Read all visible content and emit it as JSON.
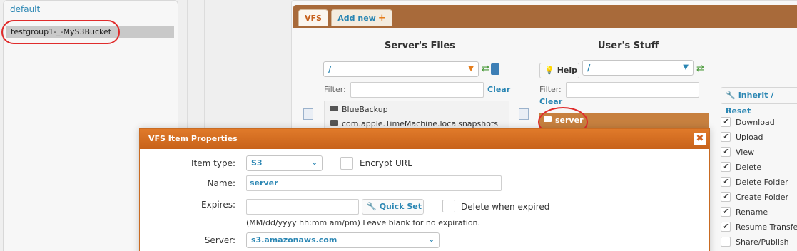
{
  "groups": {
    "default_label": "default",
    "selected_label": "testgroup1-_-MyS3Bucket"
  },
  "tabs": {
    "vfs": "VFS",
    "add_new": "Add new",
    "add_icon": "+"
  },
  "server_files": {
    "heading": "Server's Files",
    "path": "/",
    "filter_label": "Filter:",
    "clear_label": "Clear",
    "items": [
      "BlueBackup",
      "com.apple.TimeMachine.localsnapshots"
    ]
  },
  "user_stuff": {
    "heading": "User's Stuff",
    "help_label": "Help",
    "path": "/",
    "filter_label": "Filter:",
    "clear_label": "Clear",
    "items": [
      "server"
    ]
  },
  "permissions": {
    "inherit_reset_label": "Inherit / Reset",
    "items": [
      {
        "label": "Download",
        "checked": true
      },
      {
        "label": "Upload",
        "checked": true
      },
      {
        "label": "View",
        "checked": true
      },
      {
        "label": "Delete",
        "checked": true
      },
      {
        "label": "Delete Folder",
        "checked": true
      },
      {
        "label": "Create Folder",
        "checked": true
      },
      {
        "label": "Rename",
        "checked": true
      },
      {
        "label": "Resume Transfer",
        "checked": true
      },
      {
        "label": "Share/Publish",
        "checked": false
      }
    ]
  },
  "dialog": {
    "title": "VFS Item Properties",
    "close_icon": "✖",
    "item_type_label": "Item type:",
    "item_type_value": "S3",
    "encrypt_url_label": "Encrypt URL",
    "name_label": "Name:",
    "name_value": "server",
    "expires_label": "Expires:",
    "expires_value": "",
    "quick_set_label": "Quick Set",
    "delete_when_expired_label": "Delete when expired",
    "expires_hint": "(MM/dd/yyyy hh:mm am/pm) Leave blank for no expiration.",
    "server_label": "Server:",
    "server_value": "s3.amazonaws.com"
  },
  "annotation_color": "#e02c2c",
  "accent_color": "#c8621a"
}
